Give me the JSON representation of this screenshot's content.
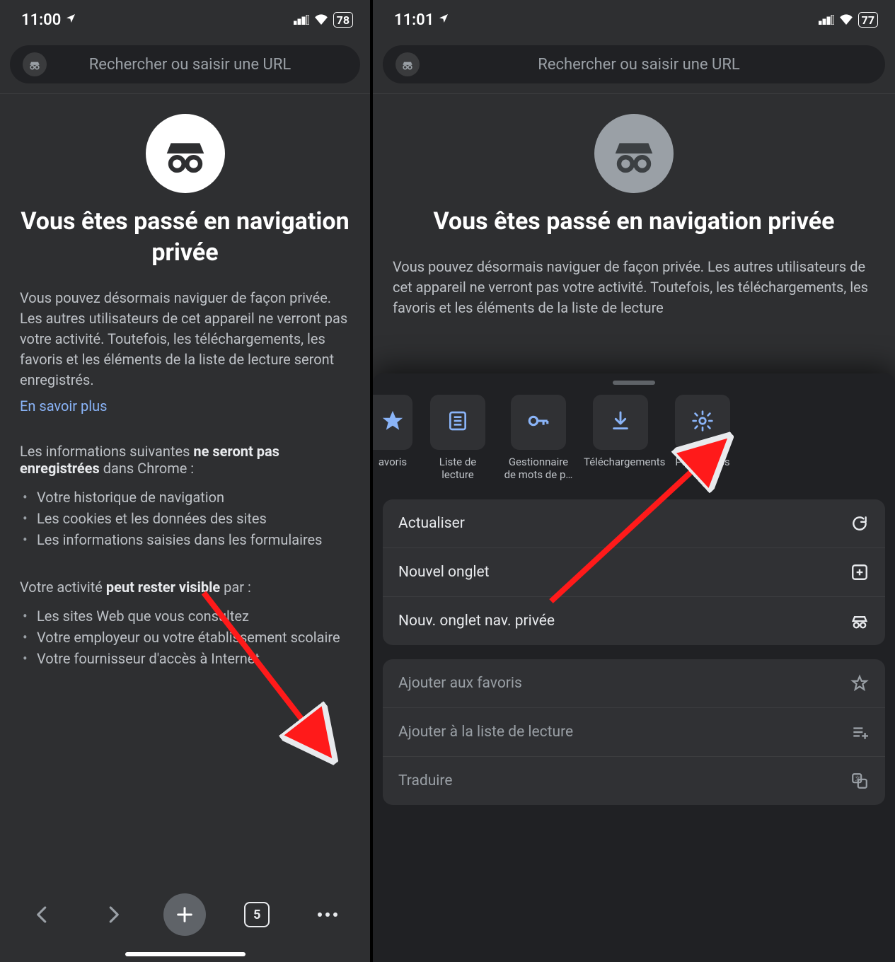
{
  "left": {
    "status": {
      "time": "11:00",
      "battery": "78"
    },
    "omnibox_placeholder": "Rechercher ou saisir une URL",
    "hero_title": "Vous êtes passé en navigation privée",
    "intro": "Vous pouvez désormais naviguer de façon privée. Les autres utilisateurs de cet appareil ne verront pas votre activité. Toutefois, les téléchargements, les favoris et les éléments de la liste de lecture seront enregistrés.",
    "learn_more": "En savoir plus",
    "not_saved_prefix": "Les informations suivantes ",
    "not_saved_bold": "ne seront pas enregistrées",
    "not_saved_suffix": " dans Chrome :",
    "not_saved_items": [
      "Votre historique de navigation",
      "Les cookies et les données des sites",
      "Les informations saisies dans les formulaires"
    ],
    "visible_prefix": "Votre activité ",
    "visible_bold": "peut rester visible",
    "visible_suffix": " par :",
    "visible_items": [
      "Les sites Web que vous consultez",
      "Votre employeur ou votre établissement scolaire",
      "Votre fournisseur d'accès à Internet"
    ],
    "tab_count": "5"
  },
  "right": {
    "status": {
      "time": "11:01",
      "battery": "77"
    },
    "omnibox_placeholder": "Rechercher ou saisir une URL",
    "hero_title": "Vous êtes passé en navigation privée",
    "intro": "Vous pouvez désormais naviguer de façon privée. Les autres utilisateurs de cet appareil ne verront pas votre activité. Toutefois, les téléchargements, les favoris et les éléments de la liste de lecture",
    "shortcuts": [
      {
        "label": "avoris",
        "icon": "star"
      },
      {
        "label": "Liste de lecture",
        "icon": "list"
      },
      {
        "label": "Gestionnaire de mots de p…",
        "icon": "key"
      },
      {
        "label": "Téléchargements",
        "icon": "download"
      },
      {
        "label": "Paramètres",
        "icon": "gear"
      }
    ],
    "menu1": [
      {
        "label": "Actualiser",
        "icon": "refresh"
      },
      {
        "label": "Nouvel onglet",
        "icon": "plus-box"
      },
      {
        "label": "Nouv. onglet nav. privée",
        "icon": "incognito"
      }
    ],
    "menu2": [
      {
        "label": "Ajouter aux favoris",
        "icon": "star-outline"
      },
      {
        "label": "Ajouter à la liste de lecture",
        "icon": "add-list"
      },
      {
        "label": "Traduire",
        "icon": "translate"
      }
    ]
  }
}
